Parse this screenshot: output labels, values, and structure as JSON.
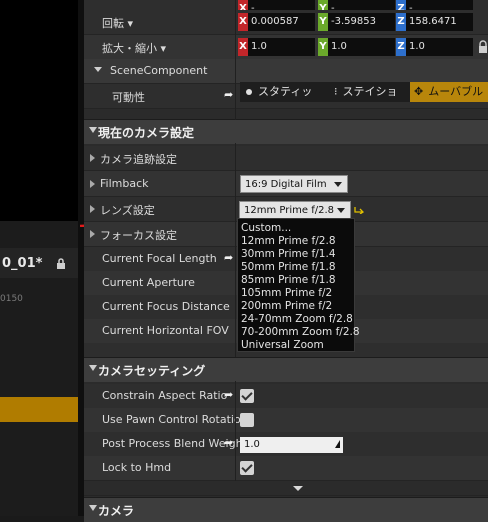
{
  "transform": {
    "top_value": "-",
    "rotation_label": "回転 ▾",
    "rotation": {
      "x": "0.000587",
      "y": "-3.59853",
      "z": "158.6471"
    },
    "scale_label": "拡大・縮小 ▾",
    "scale": {
      "x": "1.0",
      "y": "1.0",
      "z": "1.0"
    }
  },
  "scene_component": {
    "label": "SceneComponent",
    "mobility_label": "可動性",
    "options": [
      "スタティッ",
      "ステイショ",
      "ムーバブル"
    ]
  },
  "sections": {
    "current_camera": "現在のカメラ設定",
    "camera_setting": "カメラセッティング",
    "camera": "カメラ"
  },
  "rows": {
    "camera_tracking": "カメラ追跡設定",
    "filmback": "Filmback",
    "filmback_value": "16:9 Digital Film",
    "lens": "レンズ設定",
    "lens_value": "12mm Prime f/2.8",
    "focus": "フォーカス設定",
    "focal_length": "Current Focal Length",
    "aperture": "Current Aperture",
    "focus_distance": "Current Focus Distance",
    "horizontal_fov": "Current Horizontal FOV",
    "constrain": "Constrain Aspect Ratio",
    "pawn_rotation": "Use Pawn Control Rotation",
    "post_process": "Post Process Blend Weight",
    "post_process_value": "1.0",
    "lock_hmd": "Lock to Hmd"
  },
  "checkboxes": {
    "constrain": true,
    "pawn_rotation": false,
    "lock_hmd": true
  },
  "lens_options": [
    "Custom...",
    "12mm Prime f/2.8",
    "30mm Prime f/1.4",
    "50mm Prime f/1.8",
    "85mm Prime f/1.8",
    "105mm Prime f/2",
    "200mm Prime f/2",
    "24-70mm Zoom f/2.8",
    "70-200mm Zoom f/2.8",
    "Universal Zoom"
  ],
  "left_panel": {
    "tab_label": "0_01*",
    "sub_label": "0150"
  },
  "colors": {
    "accent": "#b8860b",
    "x_axis": "#c2262a",
    "y_axis": "#6ba92b",
    "z_axis": "#2d6fcc",
    "annotation": "#e01b1b"
  }
}
